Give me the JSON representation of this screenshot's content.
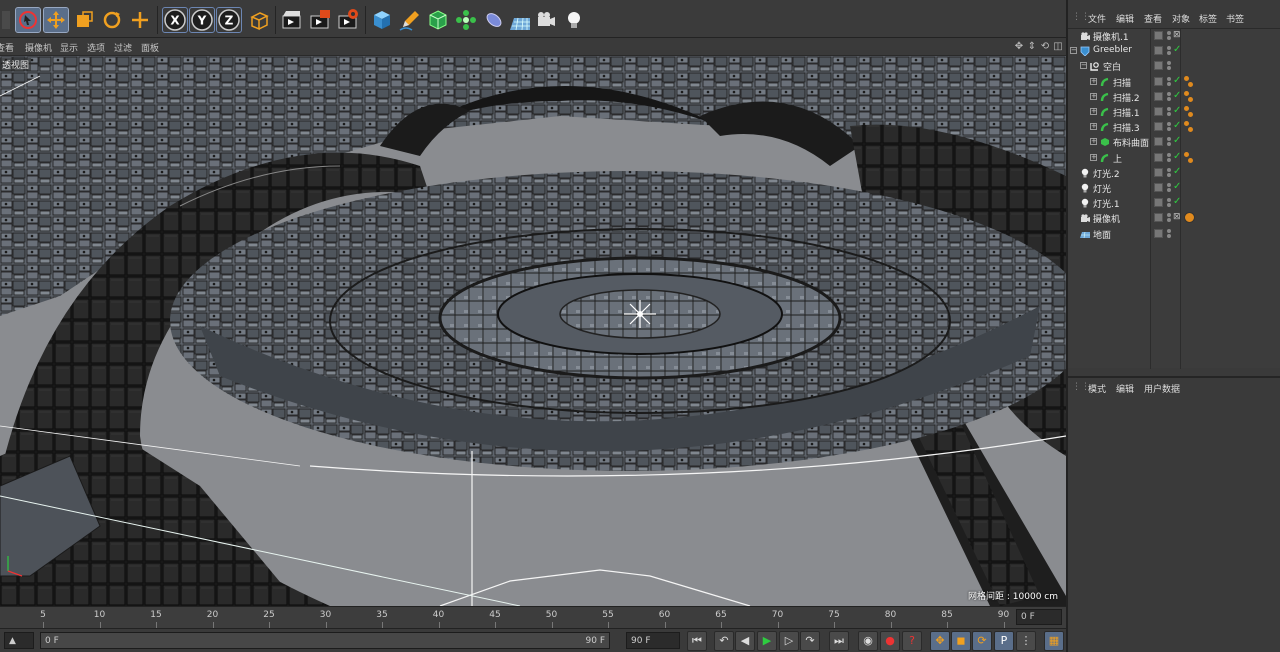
{
  "colors": {
    "accent": "#5a6e8a",
    "check_green": "#2ecc40",
    "tag_orange": "#e08a1e",
    "viewport_bg": "#8a8c90"
  },
  "toolbar": {
    "icons": [
      "undo-icon",
      "live-selection-icon",
      "move-icon",
      "scale-icon",
      "rotate-icon",
      "move-last-icon",
      "x-axis-icon",
      "y-axis-icon",
      "z-axis-icon",
      "world-coordinates-icon",
      "render-view-icon",
      "render-picture-viewer-icon",
      "render-settings-icon",
      "cube-icon",
      "pen-icon",
      "subdivision-icon",
      "cloner-icon",
      "deformer-icon",
      "floor-icon",
      "camera-icon",
      "light-icon"
    ],
    "axis_labels": [
      "X",
      "Y",
      "Z"
    ]
  },
  "viewport": {
    "menu": [
      "查看",
      "摄像机",
      "显示",
      "选项",
      "过滤",
      "面板"
    ],
    "label": "透视图",
    "grid_spacing": "网格间距 : 10000 cm"
  },
  "timeline": {
    "ticks": [
      "5",
      "10",
      "15",
      "20",
      "25",
      "30",
      "35",
      "40",
      "45",
      "50",
      "55",
      "60",
      "65",
      "70",
      "75",
      "80",
      "85",
      "90"
    ],
    "current_frame": "0 F"
  },
  "transport": {
    "start_field": "0 F",
    "range_end": "90 F",
    "end_field": "90 F"
  },
  "object_manager": {
    "menu": [
      "文件",
      "编辑",
      "查看",
      "对象",
      "标签",
      "书签"
    ],
    "objects": [
      {
        "name": "摄像机.1",
        "icon": "camera-icon",
        "depth": 0,
        "check": false,
        "tag": "none"
      },
      {
        "name": "Greebler",
        "icon": "greebler-icon",
        "depth": 0,
        "check": true,
        "tag": "none"
      },
      {
        "name": "空白",
        "icon": "null-icon",
        "depth": 1,
        "check": false,
        "tag": "none"
      },
      {
        "name": "扫描",
        "icon": "sweep-icon",
        "depth": 2,
        "check": true,
        "tag": "phong"
      },
      {
        "name": "扫描.2",
        "icon": "sweep-icon",
        "depth": 2,
        "check": true,
        "tag": "phong"
      },
      {
        "name": "扫描.1",
        "icon": "sweep-icon",
        "depth": 2,
        "check": true,
        "tag": "phong"
      },
      {
        "name": "扫描.3",
        "icon": "sweep-icon",
        "depth": 2,
        "check": true,
        "tag": "phong"
      },
      {
        "name": "布料曲面",
        "icon": "cloth-surface-icon",
        "depth": 2,
        "check": true,
        "tag": "none"
      },
      {
        "name": "上",
        "icon": "sweep-icon",
        "depth": 2,
        "check": true,
        "tag": "phong"
      },
      {
        "name": "灯光.2",
        "icon": "light-icon",
        "depth": 0,
        "check": true,
        "tag": "none"
      },
      {
        "name": "灯光",
        "icon": "light-icon",
        "depth": 0,
        "check": true,
        "tag": "none"
      },
      {
        "name": "灯光.1",
        "icon": "light-icon",
        "depth": 0,
        "check": true,
        "tag": "none"
      },
      {
        "name": "摄像机",
        "icon": "camera-icon",
        "depth": 0,
        "check": false,
        "tag": "target"
      },
      {
        "name": "地面",
        "icon": "floor-icon",
        "depth": 0,
        "check": false,
        "tag": "none"
      }
    ]
  },
  "attributes": {
    "menu": [
      "模式",
      "编辑",
      "用户数据"
    ]
  }
}
